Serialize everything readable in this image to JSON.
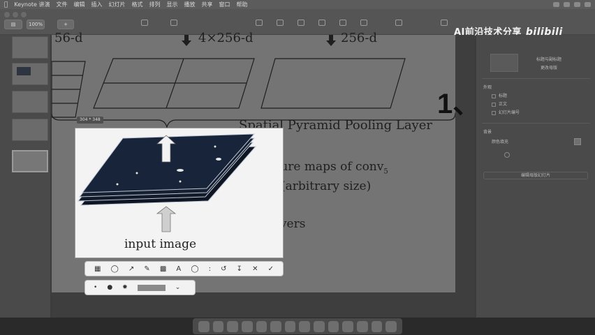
{
  "menubar": {
    "app_name": "Keynote 讲演",
    "items": [
      "文件",
      "编辑",
      "插入",
      "幻灯片",
      "格式",
      "排列",
      "显示",
      "播放",
      "共享",
      "窗口",
      "帮助"
    ]
  },
  "toolbar": {
    "zoom_value": "100%"
  },
  "watermark": {
    "text": "AI前沿技术分享",
    "brand": "bilibili"
  },
  "slide": {
    "top_labels": [
      "56-d",
      "4×256-d",
      "256-d"
    ],
    "spp_label": "Spatial Pyramid Pooling Layer",
    "big_number": "1、",
    "feature_label_line1": "feature maps of conv",
    "feature_label_sub": "5",
    "feature_label_line2": "(arbitrary size)",
    "conv_label": "convolutional layers",
    "input_label": "input image"
  },
  "image": {
    "size_badge": "304 * 348"
  },
  "markup_bar": {
    "tools": [
      "sketch",
      "shapes",
      "arrow",
      "draw",
      "mask",
      "text",
      "sign",
      "rotate",
      "save",
      "cancel",
      "confirm"
    ]
  },
  "style_bar": {
    "brush_sizes": [
      "small-dot",
      "medium-dot",
      "large-dot"
    ]
  },
  "inspector": {
    "title_text": "标题与副标题",
    "change_master": "更改母版",
    "appearance": "外观",
    "opt_title": "标题",
    "opt_body": "正文",
    "opt_slide_number": "幻灯片编号",
    "background": "背景",
    "fill_label": "颜色填充",
    "edit_master": "编辑母版幻灯片"
  },
  "dock": {
    "apps": [
      "finder",
      "launchpad",
      "safari",
      "chrome",
      "mail",
      "photos",
      "preview",
      "settings",
      "keynote",
      "calendar",
      "music",
      "terminal",
      "notes",
      "trash"
    ]
  }
}
